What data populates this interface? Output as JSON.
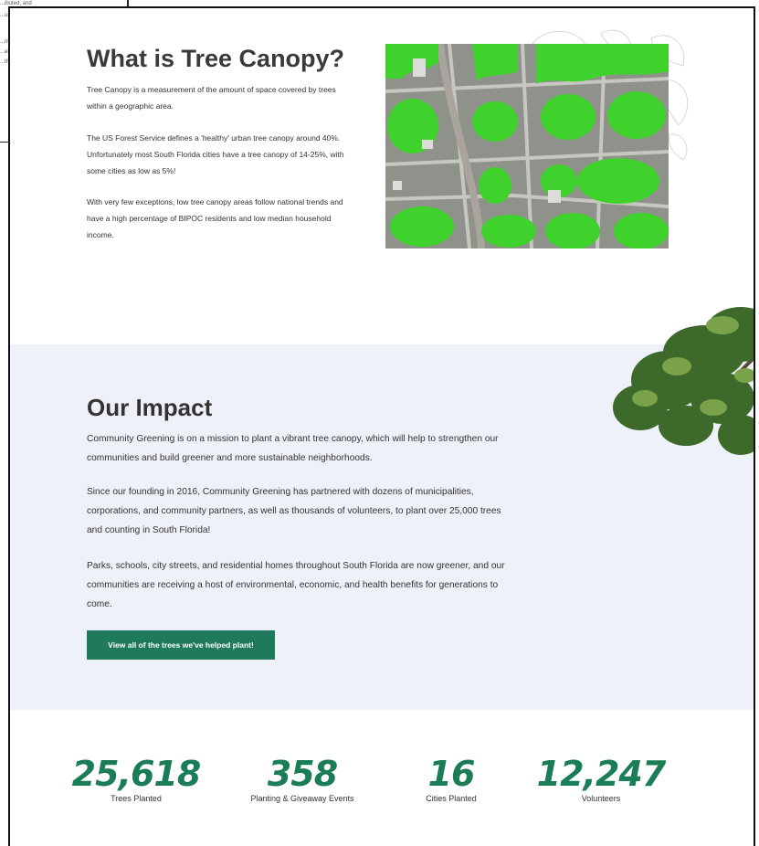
{
  "background_window": {
    "lines": [
      "...ibuted, and",
      "...uri",
      "...nt",
      "...er",
      "...th"
    ]
  },
  "canopy": {
    "title": "What is Tree Canopy?",
    "paragraphs": [
      "Tree Canopy is a measurement of the amount of space covered by trees within a geographic area.",
      "The US Forest Service defines a 'healthy' urban tree canopy around 40%. Unfortunately most South Florida cities have a tree canopy of 14-25%, with some cities as low as 5%!",
      "With very few exceptions, low tree canopy areas follow national trends and have a high percentage of BIPOC residents and low median household income."
    ]
  },
  "impact": {
    "title": "Our Impact",
    "paragraphs": [
      "Community Greening is on a mission to plant a vibrant tree canopy, which will help to strengthen our communities and build greener and more sustainable neighborhoods.",
      "Since our founding in 2016, Community Greening has partnered with dozens of municipalities, corporations, and community partners, as well as thousands of volunteers, to plant over 25,000 trees and counting in South Florida!",
      "Parks, schools, city streets, and residential homes throughout South Florida are now greener, and our communities are receiving a host of environmental, economic, and health benefits for generations to come."
    ],
    "cta_label": "View all of the trees we've helped plant!"
  },
  "stats": [
    {
      "value": "25,618",
      "label": "Trees Planted"
    },
    {
      "value": "358",
      "label": "Planting & Giveaway Events"
    },
    {
      "value": "16",
      "label": "Cities Planted"
    },
    {
      "value": "12,247",
      "label": "Volunteers"
    }
  ],
  "colors": {
    "brand_green": "#1e7a5a",
    "section_bg": "#eef2f8",
    "canopy_green": "#3fd22c"
  }
}
